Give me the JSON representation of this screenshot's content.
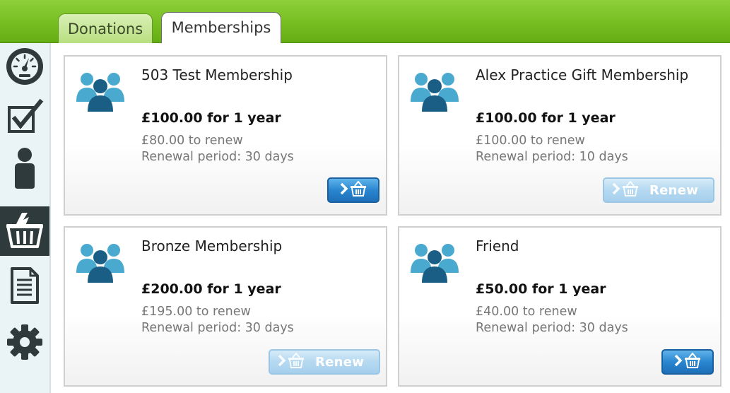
{
  "tabs": [
    {
      "label": "Donations",
      "active": false
    },
    {
      "label": "Memberships",
      "active": true
    }
  ],
  "sidebar": {
    "items": [
      {
        "icon": "dashboard-gauge-icon",
        "active": false
      },
      {
        "icon": "checklist-icon",
        "active": false
      },
      {
        "icon": "person-icon",
        "active": false
      },
      {
        "icon": "basket-icon",
        "active": true
      },
      {
        "icon": "document-icon",
        "active": false
      },
      {
        "icon": "gear-icon",
        "active": false
      }
    ]
  },
  "memberships": [
    {
      "name": "503 Test Membership",
      "price": "£100.00 for 1 year",
      "renew_price": "£80.00 to renew",
      "renewal_period": "Renewal period: 30 days",
      "button": {
        "label": "",
        "enabled": true
      }
    },
    {
      "name": "Alex Practice Gift Membership",
      "price": "£100.00 for 1 year",
      "renew_price": "£100.00 to renew",
      "renewal_period": "Renewal period: 10 days",
      "button": {
        "label": "Renew",
        "enabled": false
      }
    },
    {
      "name": "Bronze Membership",
      "price": "£200.00 for 1 year",
      "renew_price": "£195.00 to renew",
      "renewal_period": "Renewal period: 30 days",
      "button": {
        "label": "Renew",
        "enabled": false
      }
    },
    {
      "name": "Friend",
      "price": "£50.00 for 1 year",
      "renew_price": "£40.00 to renew",
      "renewal_period": "Renewal period: 30 days",
      "button": {
        "label": "",
        "enabled": true
      }
    }
  ],
  "colors": {
    "header_green": "#76bd22",
    "button_blue": "#2a86d0",
    "button_disabled_blue": "#b5d9f1",
    "sidebar_active": "#2f3a3c",
    "people_icon_blue": "#1f6f9a"
  }
}
